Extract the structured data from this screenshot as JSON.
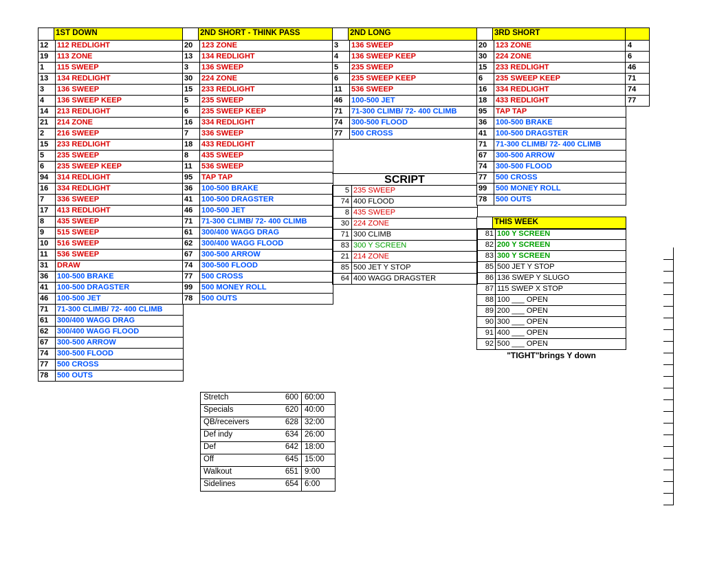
{
  "headers": {
    "col1": "1ST DOWN",
    "col2": "2ND SHORT - THINK PASS",
    "col3": "2ND LONG",
    "col4": "3RD SHORT",
    "script": "SCRIPT",
    "thisweek": "THIS WEEK"
  },
  "col1": [
    {
      "n": "12",
      "t": "112 REDLIGHT",
      "c": "red"
    },
    {
      "n": "19",
      "t": "113 ZONE",
      "c": "red"
    },
    {
      "n": "1",
      "t": "115 SWEEP",
      "c": "red"
    },
    {
      "n": "13",
      "t": "134 REDLIGHT",
      "c": "red"
    },
    {
      "n": "3",
      "t": "136 SWEEP",
      "c": "red"
    },
    {
      "n": "4",
      "t": "136 SWEEP KEEP",
      "c": "red"
    },
    {
      "n": "14",
      "t": "213 REDLIGHT",
      "c": "red"
    },
    {
      "n": "21",
      "t": "214 ZONE",
      "c": "red"
    },
    {
      "n": "2",
      "t": "216 SWEEP",
      "c": "red"
    },
    {
      "n": "15",
      "t": "233 REDLIGHT",
      "c": "red"
    },
    {
      "n": "5",
      "t": "235 SWEEP",
      "c": "red"
    },
    {
      "n": "6",
      "t": "235 SWEEP KEEP",
      "c": "red"
    },
    {
      "n": "94",
      "t": "314 REDLIGHT",
      "c": "red"
    },
    {
      "n": "16",
      "t": "334 REDLIGHT",
      "c": "red"
    },
    {
      "n": "7",
      "t": "336 SWEEP",
      "c": "red"
    },
    {
      "n": "17",
      "t": "413 REDLIGHT",
      "c": "red"
    },
    {
      "n": "8",
      "t": "435 SWEEP",
      "c": "red"
    },
    {
      "n": "9",
      "t": "515 SWEEP",
      "c": "red"
    },
    {
      "n": "10",
      "t": "516 SWEEP",
      "c": "red"
    },
    {
      "n": "11",
      "t": "536 SWEEP",
      "c": "red"
    },
    {
      "n": "31",
      "t": "DRAW",
      "c": "red"
    },
    {
      "n": "36",
      "t": "100-500 BRAKE",
      "c": "blue"
    },
    {
      "n": "41",
      "t": "100-500 DRAGSTER",
      "c": "blue"
    },
    {
      "n": "46",
      "t": "100-500 JET",
      "c": "blue"
    },
    {
      "n": "71",
      "t": "71-300 CLIMB/ 72- 400 CLIMB",
      "c": "blue"
    },
    {
      "n": "61",
      "t": "300/400 WAGG DRAG",
      "c": "blue"
    },
    {
      "n": "62",
      "t": "300/400 WAGG FLOOD",
      "c": "blue"
    },
    {
      "n": "67",
      "t": "300-500 ARROW",
      "c": "blue"
    },
    {
      "n": "74",
      "t": "300-500 FLOOD",
      "c": "blue"
    },
    {
      "n": "77",
      "t": "500 CROSS",
      "c": "blue"
    },
    {
      "n": "78",
      "t": "500 OUTS",
      "c": "blue"
    }
  ],
  "col2": [
    {
      "n": "20",
      "t": "123 ZONE",
      "c": "red"
    },
    {
      "n": "13",
      "t": "134 REDLIGHT",
      "c": "red"
    },
    {
      "n": "3",
      "t": "136 SWEEP",
      "c": "red"
    },
    {
      "n": "30",
      "t": "224 ZONE",
      "c": "red"
    },
    {
      "n": "15",
      "t": "233 REDLIGHT",
      "c": "red"
    },
    {
      "n": "5",
      "t": "235 SWEEP",
      "c": "red"
    },
    {
      "n": "6",
      "t": "235 SWEEP KEEP",
      "c": "red"
    },
    {
      "n": "16",
      "t": "334 REDLIGHT",
      "c": "red"
    },
    {
      "n": "7",
      "t": "336 SWEEP",
      "c": "red"
    },
    {
      "n": "18",
      "t": "433 REDLIGHT",
      "c": "red"
    },
    {
      "n": "8",
      "t": "435 SWEEP",
      "c": "red"
    },
    {
      "n": "11",
      "t": "536 SWEEP",
      "c": "red"
    },
    {
      "n": "95",
      "t": "TAP TAP",
      "c": "red"
    },
    {
      "n": "36",
      "t": "100-500 BRAKE",
      "c": "blue"
    },
    {
      "n": "41",
      "t": "100-500 DRAGSTER",
      "c": "blue"
    },
    {
      "n": "46",
      "t": "100-500 JET",
      "c": "blue"
    },
    {
      "n": "71",
      "t": "71-300 CLIMB/ 72- 400 CLIMB",
      "c": "blue"
    },
    {
      "n": "61",
      "t": "300/400 WAGG DRAG",
      "c": "blue"
    },
    {
      "n": "62",
      "t": "300/400 WAGG FLOOD",
      "c": "blue"
    },
    {
      "n": "67",
      "t": "300-500 ARROW",
      "c": "blue"
    },
    {
      "n": "74",
      "t": "300-500 FLOOD",
      "c": "blue"
    },
    {
      "n": "77",
      "t": "500 CROSS",
      "c": "blue"
    },
    {
      "n": "99",
      "t": "500 MONEY ROLL",
      "c": "blue"
    },
    {
      "n": "78",
      "t": "500 OUTS",
      "c": "blue"
    }
  ],
  "col3": [
    {
      "n": "3",
      "t": "136 SWEEP",
      "c": "red"
    },
    {
      "n": "4",
      "t": "136 SWEEP KEEP",
      "c": "red"
    },
    {
      "n": "5",
      "t": "235 SWEEP",
      "c": "red"
    },
    {
      "n": "6",
      "t": "235 SWEEP KEEP",
      "c": "red"
    },
    {
      "n": "11",
      "t": "536 SWEEP",
      "c": "red"
    },
    {
      "n": "46",
      "t": "100-500 JET",
      "c": "blue"
    },
    {
      "n": "71",
      "t": "71-300 CLIMB/ 72- 400 CLIMB",
      "c": "blue"
    },
    {
      "n": "74",
      "t": "300-500 FLOOD",
      "c": "blue"
    },
    {
      "n": "77",
      "t": "500 CROSS",
      "c": "blue"
    }
  ],
  "col4": [
    {
      "n": "20",
      "t": "123 ZONE",
      "c": "red"
    },
    {
      "n": "30",
      "t": "224 ZONE",
      "c": "red"
    },
    {
      "n": "15",
      "t": "233 REDLIGHT",
      "c": "red"
    },
    {
      "n": "6",
      "t": "235 SWEEP KEEP",
      "c": "red"
    },
    {
      "n": "16",
      "t": "334 REDLIGHT",
      "c": "red"
    },
    {
      "n": "18",
      "t": "433 REDLIGHT",
      "c": "red"
    },
    {
      "n": "95",
      "t": "TAP TAP",
      "c": "red"
    },
    {
      "n": "36",
      "t": "100-500 BRAKE",
      "c": "blue"
    },
    {
      "n": "41",
      "t": "100-500 DRAGSTER",
      "c": "blue"
    },
    {
      "n": "71",
      "t": "71-300 CLIMB/ 72- 400 CLIMB",
      "c": "blue"
    },
    {
      "n": "67",
      "t": "300-500 ARROW",
      "c": "blue"
    },
    {
      "n": "74",
      "t": "300-500 FLOOD",
      "c": "blue"
    },
    {
      "n": "77",
      "t": "500 CROSS",
      "c": "blue"
    },
    {
      "n": "99",
      "t": "500 MONEY ROLL",
      "c": "blue"
    },
    {
      "n": "78",
      "t": "500 OUTS",
      "c": "blue"
    }
  ],
  "col5": [
    "4",
    "6",
    "46",
    "71",
    "74",
    "77"
  ],
  "script": [
    {
      "n": "5",
      "t": "235 SWEEP",
      "c": "red"
    },
    {
      "n": "74",
      "t": "400 FLOOD",
      "c": "black"
    },
    {
      "n": "8",
      "t": "435 SWEEP",
      "c": "red"
    },
    {
      "n": "30",
      "t": "224 ZONE",
      "c": "red"
    },
    {
      "n": "71",
      "t": "300 CLIMB",
      "c": "black"
    },
    {
      "n": "83",
      "t": "300 Y SCREEN",
      "c": "green"
    },
    {
      "n": "21",
      "t": "214 ZONE",
      "c": "red"
    },
    {
      "n": "85",
      "t": "500 JET Y STOP",
      "c": "black"
    },
    {
      "n": "64",
      "t": "400 WAGG DRAGSTER",
      "c": "black"
    }
  ],
  "thisweek": [
    {
      "n": "81",
      "t": "100 Y SCREEN",
      "c": "green",
      "b": true
    },
    {
      "n": "82",
      "t": "200 Y SCREEN",
      "c": "green",
      "b": true
    },
    {
      "n": "83",
      "t": "300 Y SCREEN",
      "c": "green",
      "b": true
    },
    {
      "n": "85",
      "t": "500 JET Y STOP",
      "c": "black",
      "b": false
    },
    {
      "n": "86",
      "t": "136 SWEP Y SLUGO",
      "c": "black",
      "b": false
    },
    {
      "n": "87",
      "t": "115 SWEP X STOP",
      "c": "black",
      "b": false
    },
    {
      "n": "88",
      "t": "100 ___ OPEN",
      "c": "black",
      "b": false
    },
    {
      "n": "89",
      "t": "200 ___ OPEN",
      "c": "black",
      "b": false
    },
    {
      "n": "90",
      "t": "300 ___ OPEN",
      "c": "black",
      "b": false
    },
    {
      "n": "91",
      "t": "400 ___ OPEN",
      "c": "black",
      "b": false
    },
    {
      "n": "92",
      "t": "500 ___ OPEN",
      "c": "black",
      "b": false
    }
  ],
  "tight_note": "\"TIGHT\"brings Y down",
  "sched": [
    {
      "name": "Stretch",
      "num": "600",
      "time": "60:00"
    },
    {
      "name": "Specials",
      "num": "620",
      "time": "40:00"
    },
    {
      "name": "QB/receivers",
      "num": "628",
      "time": "32:00"
    },
    {
      "name": "Def indy",
      "num": "634",
      "time": "26:00"
    },
    {
      "name": "Def",
      "num": "642",
      "time": "18:00"
    },
    {
      "name": "Off",
      "num": "645",
      "time": "15:00"
    },
    {
      "name": "Walkout",
      "num": "651",
      "time": "9:00"
    },
    {
      "name": "Sidelines",
      "num": "654",
      "time": "6:00"
    }
  ]
}
